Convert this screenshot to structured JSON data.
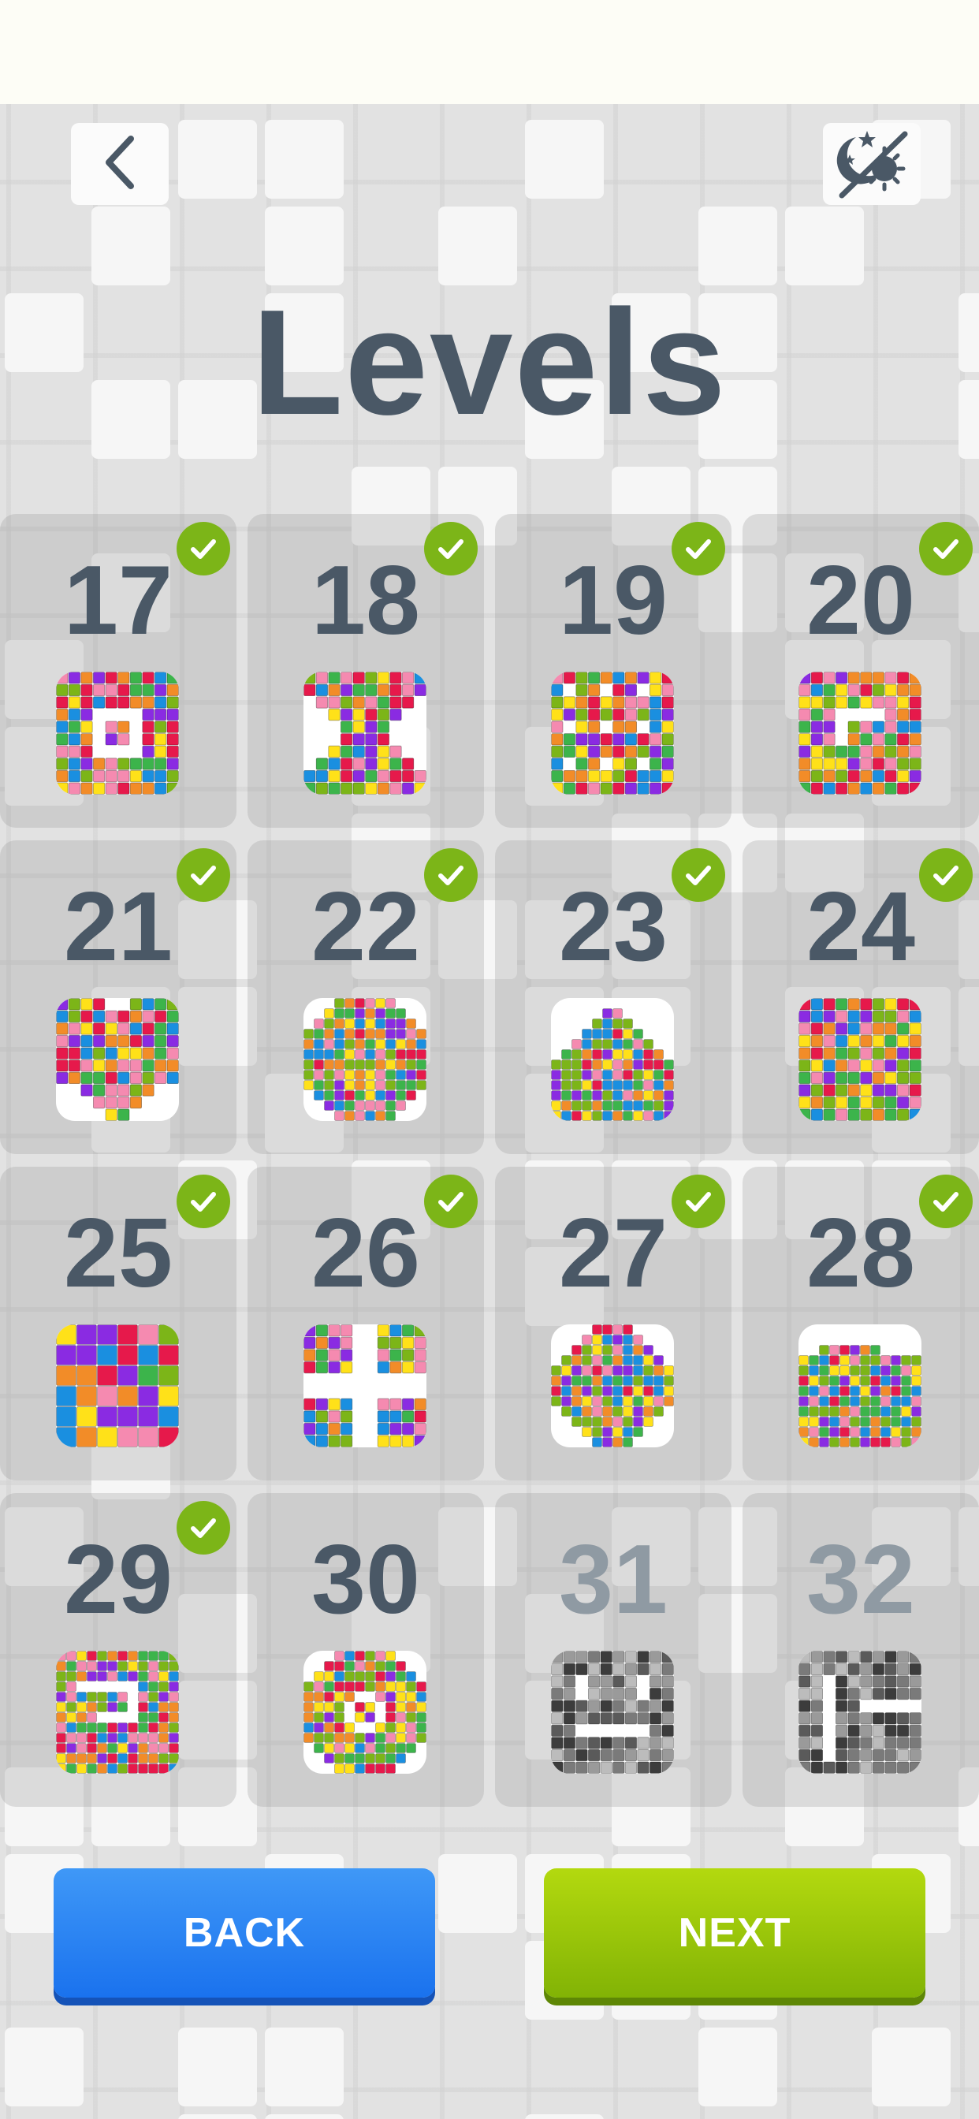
{
  "header": {
    "title": "Levels",
    "back_icon": "chevron-left-icon",
    "theme_icon": "theme-toggle-icon"
  },
  "colors": {
    "title": "#4a5866",
    "check": "#7cb518",
    "back_button": "#1a72ee",
    "next_button": "#82b305",
    "palette": [
      "#e6194b",
      "#ffe119",
      "#3cb44b",
      "#1a8fe0",
      "#8a2be2",
      "#f58ab0",
      "#7cb518",
      "#f28c28"
    ]
  },
  "levels": [
    {
      "number": "17",
      "completed": true,
      "locked": false,
      "pattern": "ring"
    },
    {
      "number": "18",
      "completed": true,
      "locked": false,
      "pattern": "hourglass"
    },
    {
      "number": "19",
      "completed": true,
      "locked": false,
      "pattern": "grid"
    },
    {
      "number": "20",
      "completed": true,
      "locked": false,
      "pattern": "swirl"
    },
    {
      "number": "21",
      "completed": true,
      "locked": false,
      "pattern": "heart"
    },
    {
      "number": "22",
      "completed": true,
      "locked": false,
      "pattern": "blob"
    },
    {
      "number": "23",
      "completed": true,
      "locked": false,
      "pattern": "house"
    },
    {
      "number": "24",
      "completed": true,
      "locked": false,
      "pattern": "checker"
    },
    {
      "number": "25",
      "completed": true,
      "locked": false,
      "pattern": "full-large"
    },
    {
      "number": "26",
      "completed": true,
      "locked": false,
      "pattern": "cross"
    },
    {
      "number": "27",
      "completed": true,
      "locked": false,
      "pattern": "octagon"
    },
    {
      "number": "28",
      "completed": true,
      "locked": false,
      "pattern": "fish"
    },
    {
      "number": "29",
      "completed": true,
      "locked": false,
      "pattern": "spiral"
    },
    {
      "number": "30",
      "completed": false,
      "locked": false,
      "pattern": "round-cross"
    },
    {
      "number": "31",
      "completed": false,
      "locked": true,
      "pattern": "face"
    },
    {
      "number": "32",
      "completed": false,
      "locked": true,
      "pattern": "letters"
    }
  ],
  "buttons": {
    "back_label": "BACK",
    "next_label": "NEXT"
  }
}
